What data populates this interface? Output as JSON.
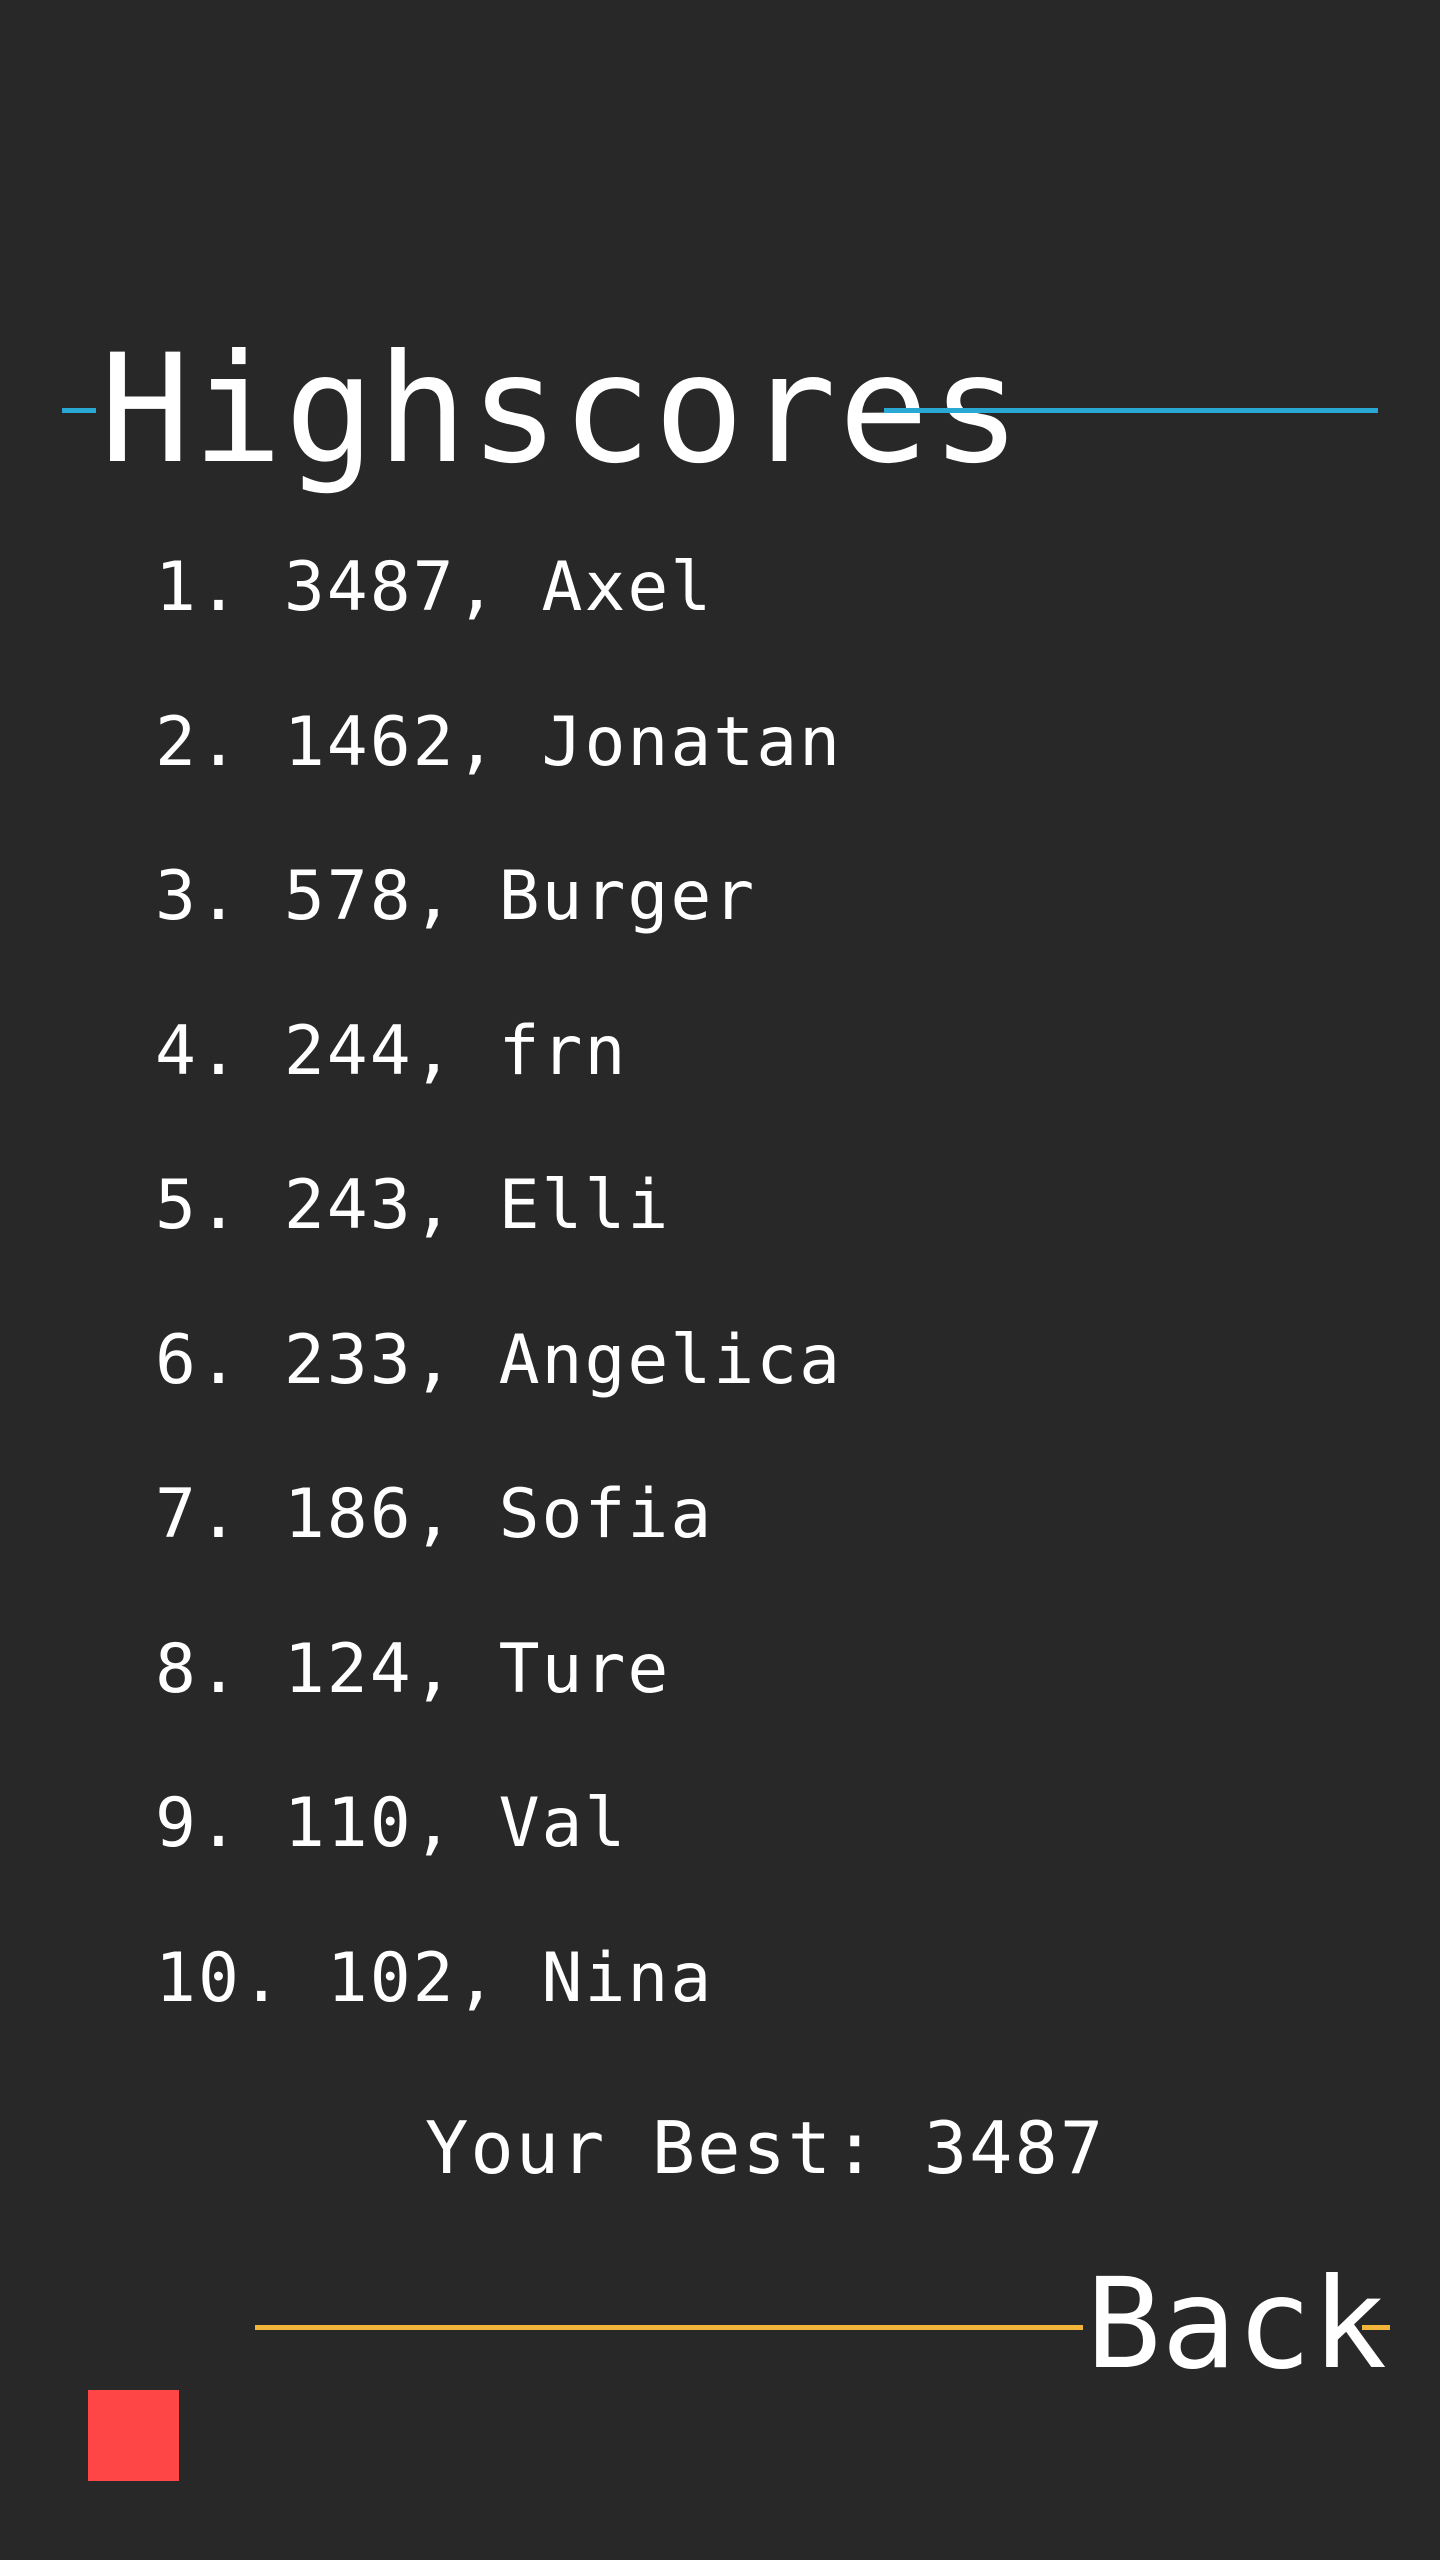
{
  "title": "Highscores",
  "scores": [
    {
      "rank": "1.",
      "score": "3487",
      "name": "Axel"
    },
    {
      "rank": "2.",
      "score": "1462",
      "name": "Jonatan"
    },
    {
      "rank": "3.",
      "score": "578",
      "name": "Burger"
    },
    {
      "rank": "4.",
      "score": "244",
      "name": "frn"
    },
    {
      "rank": "5.",
      "score": "243",
      "name": "Elli"
    },
    {
      "rank": "6.",
      "score": "233",
      "name": "Angelica"
    },
    {
      "rank": "7.",
      "score": "186",
      "name": "Sofia"
    },
    {
      "rank": "8.",
      "score": "124",
      "name": "Ture"
    },
    {
      "rank": "9.",
      "score": "110",
      "name": "Val"
    },
    {
      "rank": "10.",
      "score": "102",
      "name": "Nina"
    }
  ],
  "your_best": "Your Best: 3487",
  "back_label": "Back",
  "colors": {
    "background": "#282828",
    "title_accent": "#29a8d4",
    "back_accent": "#f1b53a",
    "square": "#ff4646",
    "text": "#ffffff"
  }
}
